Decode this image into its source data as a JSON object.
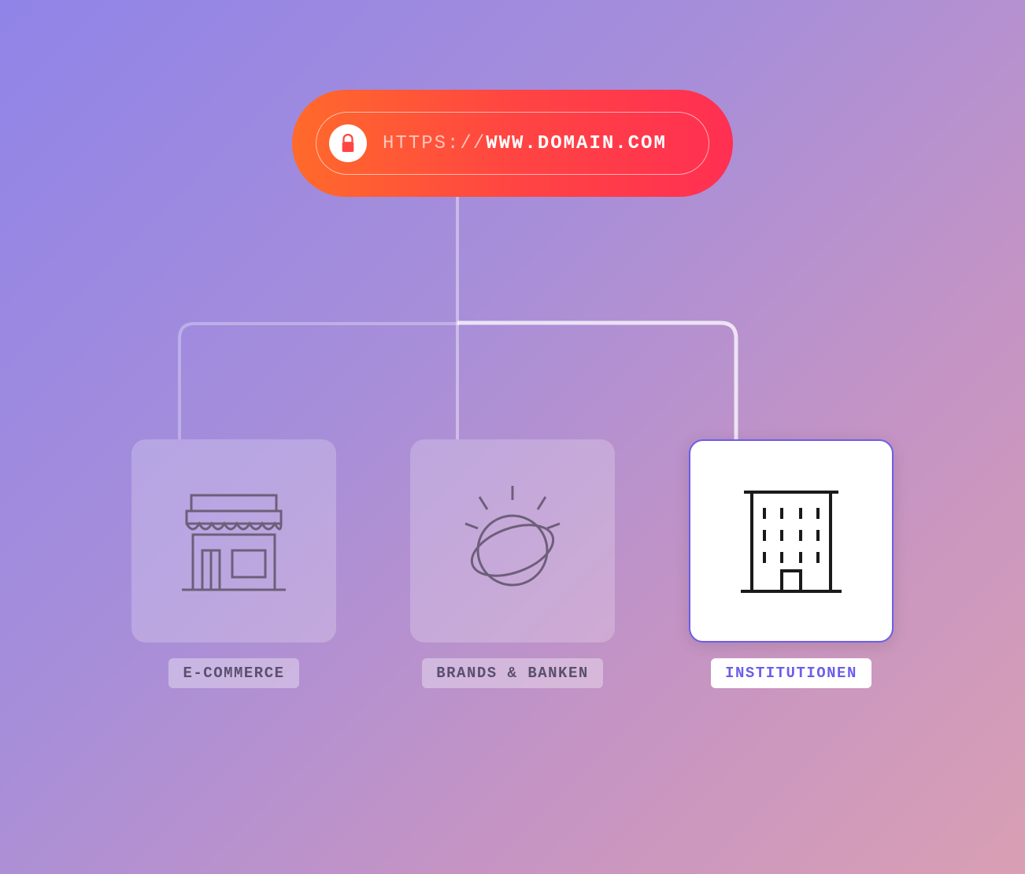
{
  "url_bar": {
    "protocol": "HTTPS://",
    "domain": "WWW.DOMAIN.COM"
  },
  "cards": [
    {
      "label": "E-COMMERCE",
      "active": false,
      "icon": "storefront"
    },
    {
      "label": "BRANDS & BANKEN",
      "active": false,
      "icon": "globe"
    },
    {
      "label": "INSTITUTIONEN",
      "active": true,
      "icon": "building"
    }
  ]
}
